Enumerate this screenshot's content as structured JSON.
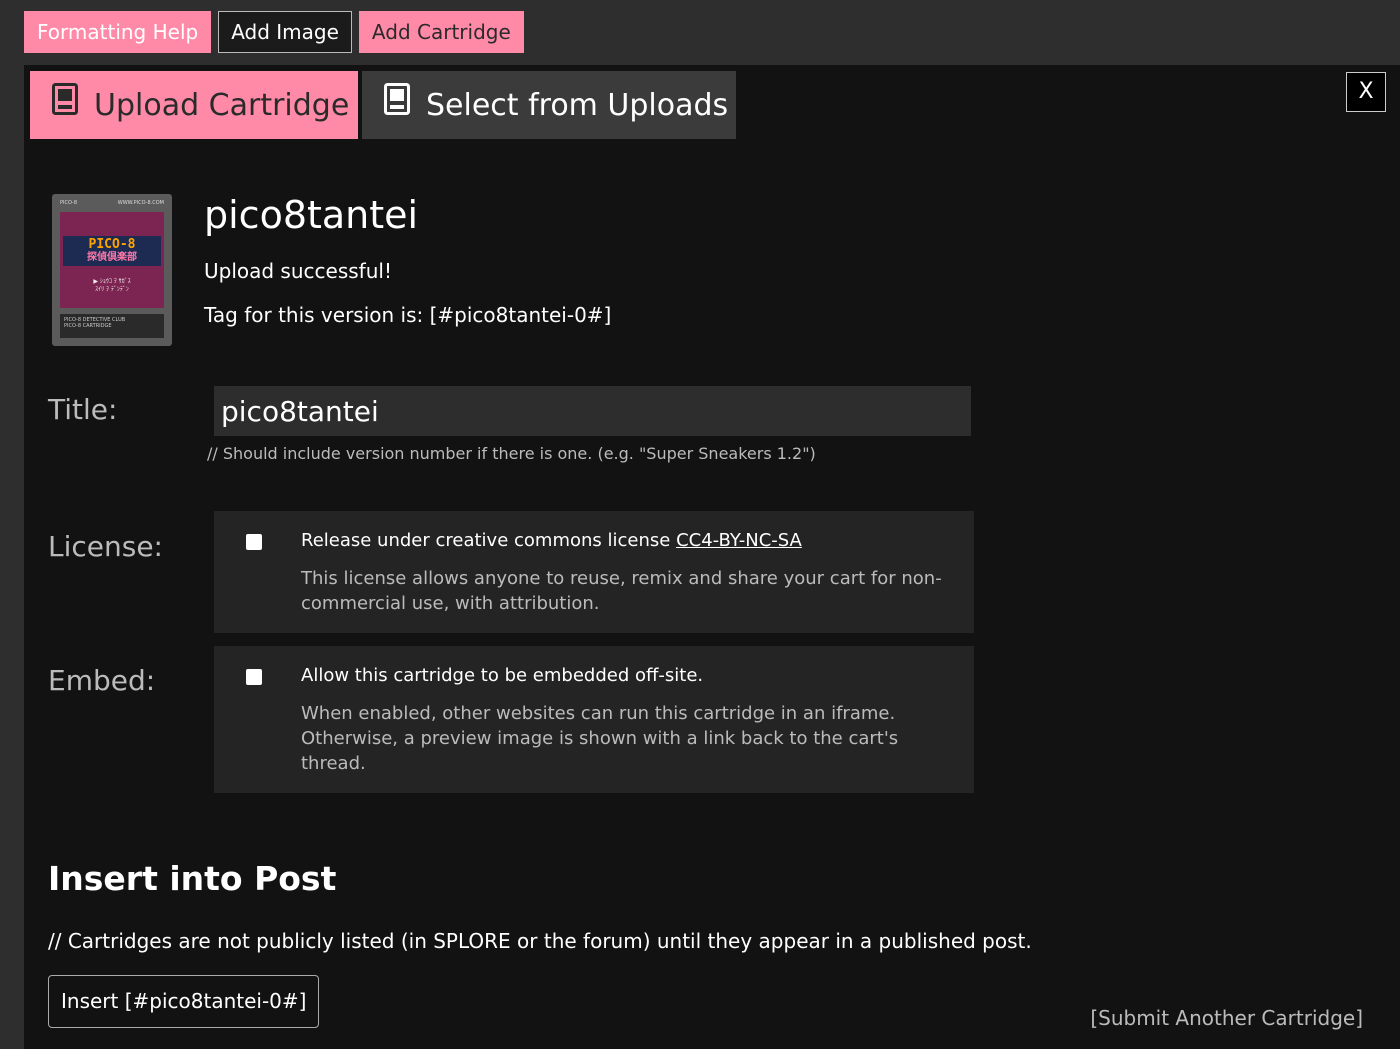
{
  "toolbar": {
    "formatting_help": "Formatting Help",
    "add_image": "Add Image",
    "add_cartridge": "Add Cartridge"
  },
  "tabs": [
    {
      "label": "Upload Cartridge",
      "icon": "cartridge-icon",
      "active": true
    },
    {
      "label": "Select from Uploads",
      "icon": "cartridge-icon",
      "active": false
    }
  ],
  "close_label": "X",
  "cartridge": {
    "name": "pico8tantei",
    "status": "Upload successful!",
    "tag_text": "Tag for this version is: [#pico8tantei-0#]"
  },
  "form": {
    "title_label": "Title:",
    "title_value": "pico8tantei",
    "title_hint": "// Should include version number if there is one. (e.g. \"Super Sneakers 1.2\")",
    "license_label": "License:",
    "license_main_prefix": "Release under creative commons license ",
    "license_link": "CC4-BY-NC-SA",
    "license_desc": "This license allows anyone to reuse, remix and share your cart for non-commercial use, with attribution.",
    "license_checked": false,
    "embed_label": "Embed:",
    "embed_main": "Allow this cartridge to be embedded off-site.",
    "embed_desc": "When enabled, other websites can run this cartridge in an iframe. Otherwise, a preview image is shown with a link back to the cart's thread.",
    "embed_checked": false
  },
  "insert": {
    "heading": "Insert into Post",
    "note": "// Cartridges are not publicly listed (in SPLORE or the forum) until they appear in a published post.",
    "button": "Insert [#pico8tantei-0#]",
    "submit_another": "[Submit Another Cartridge]"
  },
  "colors": {
    "accent_pink": "#ff8aa8",
    "dialog_bg": "#121212",
    "page_bg": "#2e2e2e"
  }
}
